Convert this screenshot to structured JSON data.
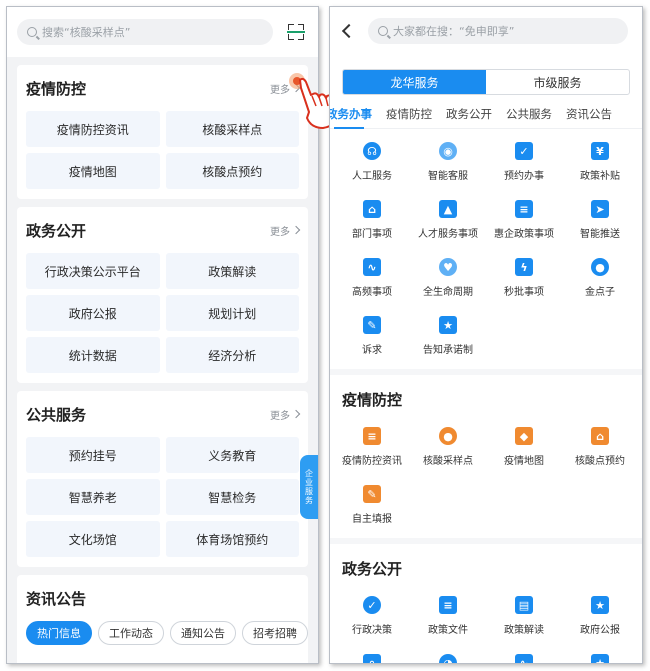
{
  "left": {
    "search_placeholder": "搜索“核酸采样点”",
    "side_tab": "企业服务",
    "sections": [
      {
        "title": "疫情防控",
        "more": "更多",
        "items": [
          "疫情防控资讯",
          "核酸采样点",
          "疫情地图",
          "核酸点预约"
        ]
      },
      {
        "title": "政务公开",
        "more": "更多",
        "items": [
          "行政决策公示平台",
          "政策解读",
          "政府公报",
          "规划计划",
          "统计数据",
          "经济分析"
        ]
      },
      {
        "title": "公共服务",
        "more": "更多",
        "items": [
          "预约挂号",
          "义务教育",
          "智慧养老",
          "智慧检务",
          "文化场馆",
          "体育场馆预约"
        ]
      }
    ],
    "news": {
      "title": "资讯公告",
      "tabs": [
        "热门信息",
        "工作动态",
        "通知公告",
        "招考招聘"
      ]
    }
  },
  "right": {
    "search_placeholder": "大家都在搜：“免申即享”",
    "segments": [
      "龙华服务",
      "市级服务"
    ],
    "tabs": [
      "政务办事",
      "疫情防控",
      "政务公开",
      "公共服务",
      "资讯公告"
    ],
    "services": [
      "人工服务",
      "智能客服",
      "预约办事",
      "政策补贴",
      "部门事项",
      "人才服务事项",
      "惠企政策事项",
      "智能推送",
      "高频事项",
      "全生命周期",
      "秒批事项",
      "金点子",
      "诉求",
      "告知承诺制"
    ],
    "epidemic": {
      "title": "疫情防控",
      "items": [
        "疫情防控资讯",
        "核酸采样点",
        "疫情地图",
        "核酸点预约",
        "自主填报"
      ]
    },
    "gov_open": {
      "title": "政务公开",
      "items": [
        "行政决策",
        "政策文件",
        "政策解读",
        "政府公报"
      ]
    }
  },
  "colors": {
    "accent": "#1a8cf0",
    "orange": "#f08a30"
  }
}
